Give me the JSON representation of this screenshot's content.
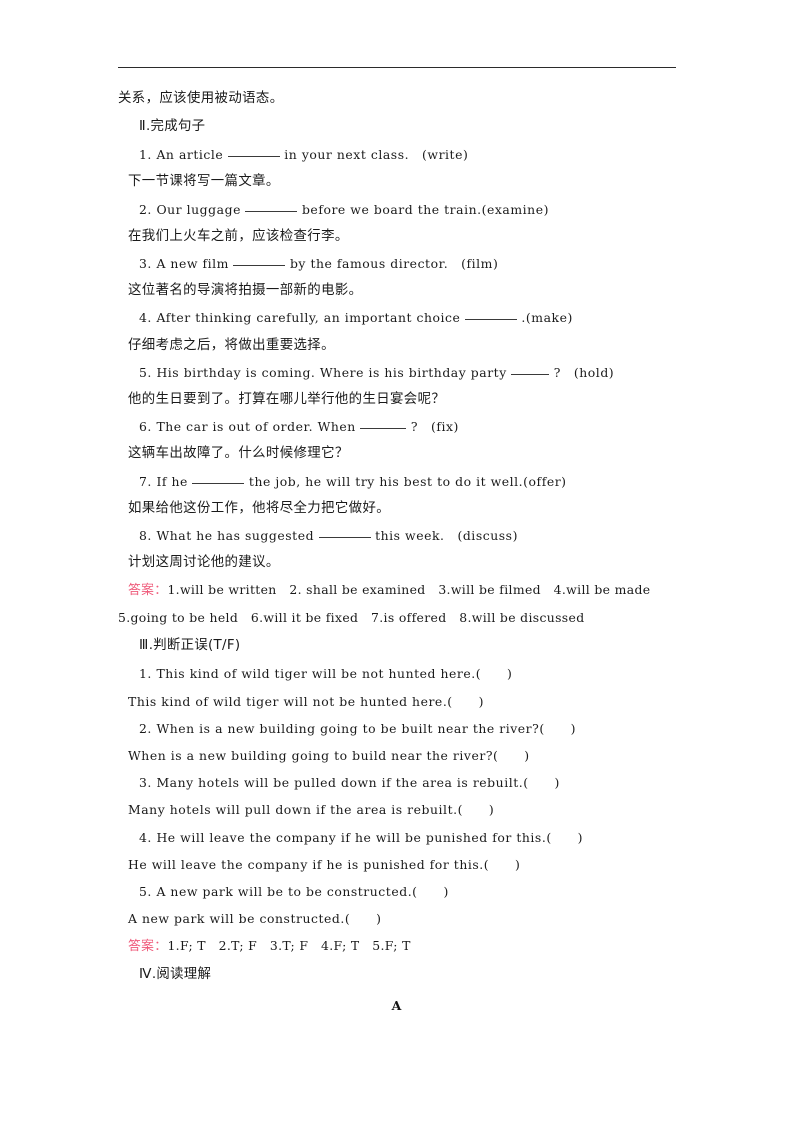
{
  "document": {
    "top_rule_color": "#2b2b2b",
    "answer_label_color": "#ef5a7a",
    "text_color": "#1a1a1a",
    "page_marker": "A"
  },
  "intro": {
    "continuation_line": "关系，应该使用被动语态。"
  },
  "sections": [
    {
      "id": "section-2",
      "roman": "Ⅱ",
      "heading_text": ".完成句子",
      "items": [
        {
          "number": "1.",
          "pre": "An article",
          "blank": "w1",
          "post": "in your next class.　(write)",
          "translation": "下一节课将写一篇文章。"
        },
        {
          "number": "2.",
          "pre": "Our luggage",
          "blank": "w1",
          "post": "before we board the train.(examine)",
          "translation": "在我们上火车之前，应该检查行李。"
        },
        {
          "number": "3.",
          "pre": "A new film",
          "blank": "w1",
          "post": "by the famous director.　(film)",
          "translation": "这位著名的导演将拍摄一部新的电影。"
        },
        {
          "number": "4.",
          "pre": "After thinking carefully, an important choice",
          "blank": "w1",
          "post": ".(make)",
          "translation": "仔细考虑之后，将做出重要选择。"
        },
        {
          "number": "5.",
          "pre": "His birthday is coming. Where is his birthday party",
          "blank": "w3",
          "post": "?　(hold)",
          "translation": "他的生日要到了。打算在哪儿举行他的生日宴会呢？"
        },
        {
          "number": "6.",
          "pre": "The car is out of order. When",
          "blank": "w2",
          "post": "?　(fix)",
          "translation": "这辆车出故障了。什么时候修理它？"
        },
        {
          "number": "7.",
          "pre": "If he",
          "blank": "w1",
          "post": "the job, he will try his best to do it well.(offer)",
          "translation": "如果给他这份工作，他将尽全力把它做好。"
        },
        {
          "number": "8.",
          "pre": "What he has suggested",
          "blank": "w1",
          "post": "this week.　(discuss)",
          "translation": "计划这周讨论他的建议。"
        }
      ],
      "answer": {
        "label": "答案：",
        "line1": "1.will be written　2. shall be examined　3.will be filmed　4.will be made",
        "line2": "5.going to be held　6.will it be fixed　7.is offered　8.will be discussed"
      }
    },
    {
      "id": "section-3",
      "roman": "Ⅲ",
      "heading_text": ".判断正误(T/F)",
      "items": [
        {
          "number": "1.",
          "a": "This kind of wild tiger will be not hunted here.(　　)",
          "b": "This kind of wild tiger will not be hunted here.(　　)"
        },
        {
          "number": "2.",
          "a": "When is a new building going to be built near the river?(　　)",
          "b": "When is a new building going to build near the river?(　　)"
        },
        {
          "number": "3.",
          "a": "Many hotels will be pulled down if the area is rebuilt.(　　)",
          "b": "Many hotels will pull down if the area is rebuilt.(　　)"
        },
        {
          "number": "4.",
          "a": "He will leave the company if he will be punished for this.(　　)",
          "b": "He will leave the company if he is punished for this.(　　)"
        },
        {
          "number": "5.",
          "a": "A new park will be to be constructed.(　　)",
          "b": "A new park will be constructed.(　　)"
        }
      ],
      "answer": {
        "label": "答案：",
        "line1": "1.F; T　2.T; F　3.T; F　4.F; T　5.F; T"
      }
    },
    {
      "id": "section-4",
      "roman": "Ⅳ",
      "heading_text": ".阅读理解",
      "items": [],
      "answer": null
    }
  ]
}
